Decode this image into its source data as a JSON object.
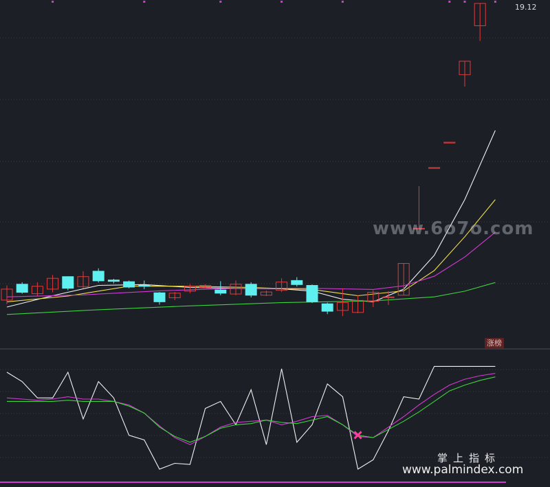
{
  "chart_data": [
    {
      "type": "candlestick",
      "price_label": "19.12",
      "badge": "涨榜",
      "ylim": [
        0,
        19.12
      ],
      "colors": {
        "up": "#e03c3c",
        "down": "#5ef0f0",
        "ma_white": "#f2f2f2",
        "ma_yellow": "#f4e04a",
        "ma_magenta": "#d33ad3",
        "ma_green": "#3ed43e"
      },
      "candles": [
        {
          "o": 1.55,
          "c": 2.2,
          "h": 2.42,
          "l": 1.31
        },
        {
          "o": 2.49,
          "c": 2.01,
          "h": 2.61,
          "l": 1.93
        },
        {
          "o": 1.93,
          "c": 2.37,
          "h": 2.61,
          "l": 1.81
        },
        {
          "o": 2.2,
          "c": 2.84,
          "h": 3.04,
          "l": 2.01
        },
        {
          "o": 2.94,
          "c": 2.25,
          "h": 2.96,
          "l": 2.13
        },
        {
          "o": 2.35,
          "c": 2.94,
          "h": 3.26,
          "l": 2.25
        },
        {
          "o": 3.26,
          "c": 2.69,
          "h": 3.43,
          "l": 2.59
        },
        {
          "o": 2.74,
          "c": 2.66,
          "h": 2.81,
          "l": 2.54
        },
        {
          "o": 2.64,
          "c": 2.32,
          "h": 2.71,
          "l": 2.25
        },
        {
          "o": 2.42,
          "c": 2.37,
          "h": 2.71,
          "l": 2.2
        },
        {
          "o": 1.98,
          "c": 1.45,
          "h": 2.03,
          "l": 1.28
        },
        {
          "o": 1.69,
          "c": 1.96,
          "h": 2.03,
          "l": 1.55
        },
        {
          "o": 2.08,
          "c": 2.37,
          "h": 2.49,
          "l": 1.96
        },
        {
          "o": 2.3,
          "c": 2.42,
          "h": 2.49,
          "l": 2.25
        },
        {
          "o": 2.15,
          "c": 1.96,
          "h": 2.67,
          "l": 1.84
        },
        {
          "o": 1.91,
          "c": 2.49,
          "h": 2.71,
          "l": 1.84
        },
        {
          "o": 2.49,
          "c": 1.84,
          "h": 2.61,
          "l": 1.71
        },
        {
          "o": 1.84,
          "c": 2.03,
          "h": 2.11,
          "l": 1.79
        },
        {
          "o": 2.13,
          "c": 2.62,
          "h": 2.84,
          "l": 2.03
        },
        {
          "o": 2.71,
          "c": 2.47,
          "h": 2.91,
          "l": 2.35
        },
        {
          "o": 2.42,
          "c": 1.45,
          "h": 2.47,
          "l": 1.38
        },
        {
          "o": 1.33,
          "c": 0.89,
          "h": 1.4,
          "l": 0.72
        },
        {
          "o": 0.94,
          "c": 1.4,
          "h": 2.25,
          "l": 0.6
        },
        {
          "o": 0.82,
          "c": 1.53,
          "h": 1.84,
          "l": 0.77
        },
        {
          "o": 1.48,
          "c": 2.01,
          "h": 2.13,
          "l": 1.14
        },
        {
          "o": 1.69,
          "c": 1.74,
          "h": 2.08,
          "l": 1.26
        },
        {
          "o": 1.84,
          "c": 3.72,
          "h": 3.72,
          "l": 1.84
        },
        {
          "o": 5.8,
          "c": 5.8,
          "h": 8.3,
          "l": 5.8
        },
        {
          "o": 9.4,
          "c": 9.4,
          "h": 9.4,
          "l": 9.4
        },
        {
          "o": 10.9,
          "c": 10.9,
          "h": 10.9,
          "l": 10.9
        },
        {
          "o": 14.9,
          "c": 15.7,
          "h": 15.7,
          "l": 14.2
        },
        {
          "o": 17.8,
          "c": 19.12,
          "h": 19.12,
          "l": 16.9
        }
      ],
      "ma": [
        {
          "color": "ma_white",
          "points": [
            [
              0,
              1.14
            ],
            [
              3,
              1.81
            ],
            [
              6,
              2.42
            ],
            [
              9,
              2.47
            ],
            [
              12,
              2.3
            ],
            [
              15,
              2.25
            ],
            [
              18,
              2.22
            ],
            [
              20,
              2.08
            ],
            [
              22,
              1.6
            ],
            [
              24,
              1.45
            ],
            [
              26,
              2.2
            ],
            [
              28,
              4.2
            ],
            [
              30,
              7.5
            ],
            [
              32,
              11.6
            ]
          ]
        },
        {
          "color": "ma_yellow",
          "points": [
            [
              0,
              1.45
            ],
            [
              4,
              1.79
            ],
            [
              8,
              2.37
            ],
            [
              12,
              2.37
            ],
            [
              16,
              2.3
            ],
            [
              20,
              2.18
            ],
            [
              23,
              1.81
            ],
            [
              26,
              2.1
            ],
            [
              28,
              3.3
            ],
            [
              30,
              5.3
            ],
            [
              32,
              7.5
            ]
          ]
        },
        {
          "color": "ma_magenta",
          "points": [
            [
              0,
              1.74
            ],
            [
              5,
              1.86
            ],
            [
              10,
              2.1
            ],
            [
              15,
              2.25
            ],
            [
              20,
              2.25
            ],
            [
              24,
              2.18
            ],
            [
              26,
              2.4
            ],
            [
              28,
              2.96
            ],
            [
              30,
              4.1
            ],
            [
              32,
              5.57
            ]
          ]
        },
        {
          "color": "ma_green",
          "points": [
            [
              0,
              0.7
            ],
            [
              6,
              0.98
            ],
            [
              12,
              1.21
            ],
            [
              18,
              1.4
            ],
            [
              24,
              1.5
            ],
            [
              28,
              1.74
            ],
            [
              30,
              2.08
            ],
            [
              32,
              2.59
            ]
          ]
        }
      ],
      "top_markers": [
        3,
        9,
        14,
        18,
        22,
        29,
        30,
        32
      ]
    },
    {
      "type": "line",
      "ylim": [
        0,
        100
      ],
      "series": [
        {
          "color": "#f2f2f2",
          "values": [
            93,
            85,
            71,
            71,
            93,
            53,
            85,
            71,
            39,
            35,
            10,
            15,
            14,
            62,
            68,
            48,
            78,
            31,
            96,
            33,
            48,
            83,
            72,
            10,
            18,
            43,
            72,
            70,
            98,
            98,
            98,
            98,
            98
          ]
        },
        {
          "color": "#d33ad3",
          "values": [
            71,
            70,
            69,
            70,
            72,
            70,
            70,
            68,
            65,
            58,
            47,
            37,
            31,
            38,
            46,
            50,
            51,
            52,
            48,
            51,
            55,
            56,
            48,
            38,
            37,
            46,
            55,
            65,
            74,
            82,
            87,
            90,
            92
          ]
        },
        {
          "color": "#3ed43e",
          "values": [
            68,
            68,
            68,
            68,
            69,
            68,
            68,
            68,
            64,
            58,
            46,
            38,
            33,
            38,
            45,
            48,
            49,
            52,
            50,
            49,
            52,
            55,
            48,
            39,
            37,
            44,
            51,
            59,
            68,
            77,
            82,
            86,
            89
          ]
        }
      ],
      "bottom_line_color": "#d33ad3",
      "cross_marker_index": 23
    }
  ],
  "watermark_top": "www.6o7o.com",
  "watermark_cn": "掌上指标",
  "watermark_url": "www.palmindex.com"
}
